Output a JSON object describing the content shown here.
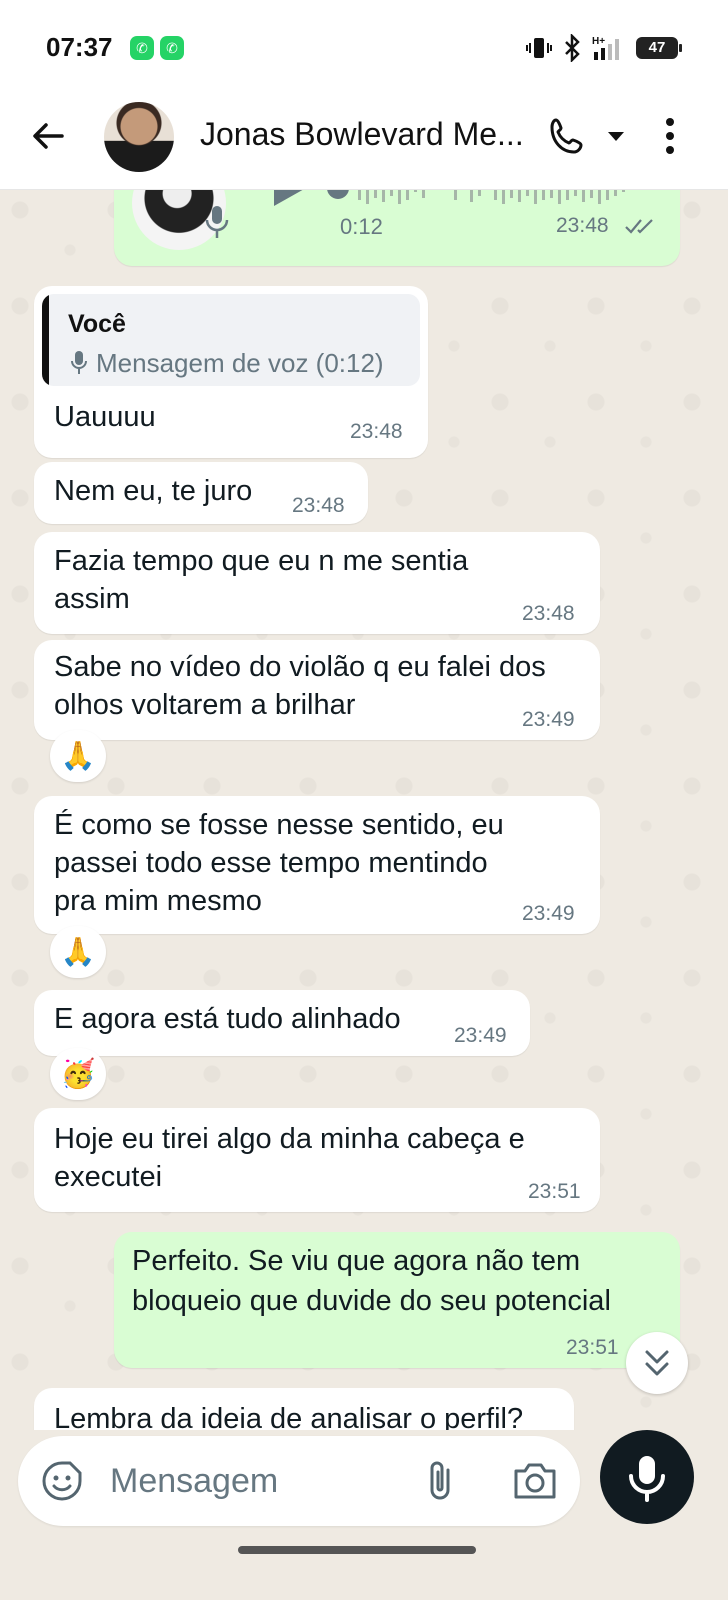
{
  "status_bar": {
    "time": "07:37",
    "battery": "47",
    "network": "H+",
    "icons": [
      "whatsapp-icon",
      "whatsapp-icon",
      "vibrate-icon",
      "bluetooth-icon",
      "signal-icon",
      "battery-icon"
    ]
  },
  "header": {
    "contact_name": "Jonas Bowlevard Me...",
    "icons": [
      "back-arrow-icon",
      "avatar",
      "phone-icon",
      "caret-down-icon",
      "more-vert-icon"
    ]
  },
  "messages": [
    {
      "id": "voice-out",
      "direction": "out",
      "type": "voice",
      "duration": "0:12",
      "time": "23:48",
      "status": "read"
    },
    {
      "id": "reply-uauuuu",
      "direction": "in",
      "quote_author": "Você",
      "quote_text": "Mensagem de voz (0:12)",
      "text": "Uauuuu",
      "time": "23:48"
    },
    {
      "id": "nem-eu",
      "direction": "in",
      "text": "Nem eu, te juro",
      "time": "23:48"
    },
    {
      "id": "fazia-tempo",
      "direction": "in",
      "lines": [
        "Fazia tempo que eu n me sentia",
        "assim"
      ],
      "time": "23:48"
    },
    {
      "id": "sabe-no-video",
      "direction": "in",
      "lines": [
        "Sabe no vídeo do violão q eu falei dos",
        "olhos voltarem a brilhar"
      ],
      "time": "23:49",
      "reaction": "🙏"
    },
    {
      "id": "e-como",
      "direction": "in",
      "lines": [
        "É como se fosse nesse sentido, eu",
        "passei todo esse tempo mentindo",
        "pra mim mesmo"
      ],
      "time": "23:49",
      "reaction": "🙏"
    },
    {
      "id": "e-agora",
      "direction": "in",
      "text": "E agora está tudo alinhado",
      "time": "23:49",
      "reaction": "🥳"
    },
    {
      "id": "hoje-eu",
      "direction": "in",
      "lines": [
        "Hoje eu tirei algo da minha cabeça e",
        "executei"
      ],
      "time": "23:51"
    },
    {
      "id": "perfeito",
      "direction": "out",
      "lines": [
        "Perfeito. Se viu que agora não tem",
        "bloqueio que duvide do seu potencial"
      ],
      "time": "23:51",
      "status": "read"
    },
    {
      "id": "lembra",
      "direction": "in",
      "text": "Lembra da ideia de analisar o perfil?"
    }
  ],
  "input": {
    "placeholder": "Mensagem"
  },
  "colors": {
    "chat_bg": "#efeae2",
    "incoming": "#ffffff",
    "outgoing": "#d9fdd3",
    "read_ticks": "#667781",
    "mic_button": "#111b21"
  }
}
